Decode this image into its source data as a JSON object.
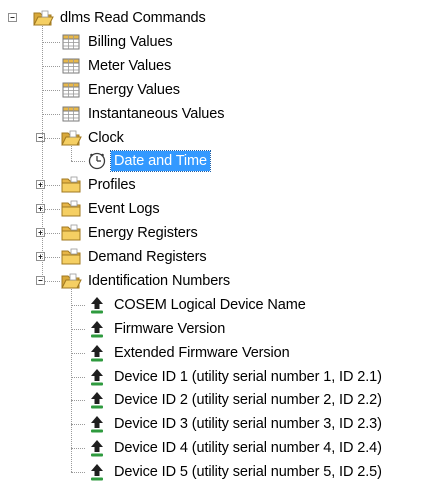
{
  "tree": {
    "root": {
      "label": "dlms Read Commands",
      "icon": "folder-open-icon",
      "expander": "-"
    },
    "children": [
      {
        "label": "Billing Values",
        "icon": "table-icon"
      },
      {
        "label": "Meter Values",
        "icon": "table-icon"
      },
      {
        "label": "Energy Values",
        "icon": "table-icon"
      },
      {
        "label": "Instantaneous Values",
        "icon": "table-icon"
      },
      {
        "label": "Clock",
        "icon": "folder-open-icon",
        "expander": "-",
        "children": [
          {
            "label": "Date and Time",
            "icon": "clock-icon",
            "selected": true
          }
        ]
      },
      {
        "label": "Profiles",
        "icon": "folder-icon",
        "expander": "+"
      },
      {
        "label": "Event Logs",
        "icon": "folder-icon",
        "expander": "+"
      },
      {
        "label": "Energy Registers",
        "icon": "folder-icon",
        "expander": "+"
      },
      {
        "label": "Demand Registers",
        "icon": "folder-icon",
        "expander": "+"
      },
      {
        "label": "Identification Numbers",
        "icon": "folder-open-icon",
        "expander": "-",
        "children": [
          {
            "label": "COSEM Logical Device Name",
            "icon": "upload-arrow-icon"
          },
          {
            "label": "Firmware Version",
            "icon": "upload-arrow-icon"
          },
          {
            "label": "Extended Firmware Version",
            "icon": "upload-arrow-icon"
          },
          {
            "label": "Device ID 1 (utility serial number 1, ID 2.1)",
            "icon": "upload-arrow-icon"
          },
          {
            "label": "Device ID 2 (utility serial number 2, ID 2.2)",
            "icon": "upload-arrow-icon"
          },
          {
            "label": "Device ID 3 (utility serial number 3, ID 2.3)",
            "icon": "upload-arrow-icon"
          },
          {
            "label": "Device ID 4 (utility serial number 4, ID 2.4)",
            "icon": "upload-arrow-icon"
          },
          {
            "label": "Device ID 5 (utility serial number 5, ID 2.5)",
            "icon": "upload-arrow-icon"
          }
        ]
      }
    ]
  },
  "colors": {
    "selection": "#3399ff",
    "folder": "#f2c14e",
    "table_header": "#e8b84a",
    "arrow": "#1f1f1f",
    "arrow_base": "#2e9a3e"
  }
}
